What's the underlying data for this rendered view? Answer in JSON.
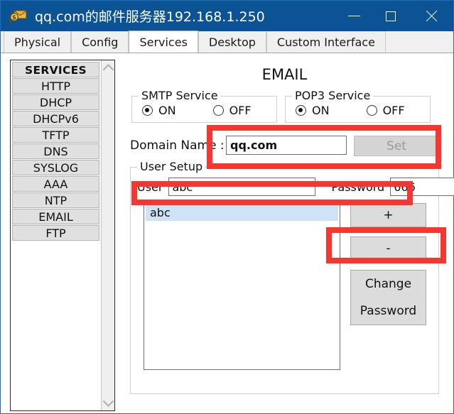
{
  "window": {
    "title": "qq.com的邮件服务器192.168.1.250",
    "icon": "mail-server-icon",
    "controls": {
      "minimize": "minimize-icon",
      "maximize": "maximize-icon",
      "close": "close-icon"
    }
  },
  "tabs": [
    {
      "label": "Physical",
      "active": false
    },
    {
      "label": "Config",
      "active": false
    },
    {
      "label": "Services",
      "active": true
    },
    {
      "label": "Desktop",
      "active": false
    },
    {
      "label": "Custom Interface",
      "active": false
    }
  ],
  "sidebar": {
    "header": "SERVICES",
    "items": [
      {
        "label": "HTTP"
      },
      {
        "label": "DHCP"
      },
      {
        "label": "DHCPv6"
      },
      {
        "label": "TFTP"
      },
      {
        "label": "DNS"
      },
      {
        "label": "SYSLOG"
      },
      {
        "label": "AAA"
      },
      {
        "label": "NTP"
      },
      {
        "label": "EMAIL"
      },
      {
        "label": "FTP"
      }
    ],
    "scrollbar": {
      "up": "chevron-up-icon",
      "down": "chevron-down-icon"
    }
  },
  "panel": {
    "title": "EMAIL",
    "smtp": {
      "group_label": "SMTP Service",
      "on_label": "ON",
      "off_label": "OFF",
      "selected": "ON"
    },
    "pop3": {
      "group_label": "POP3 Service",
      "on_label": "ON",
      "off_label": "OFF",
      "selected": "ON"
    },
    "domain": {
      "label": "Domain Name :",
      "value": "qq.com",
      "placeholder": "",
      "set_button": "Set",
      "set_button_disabled": true
    },
    "user_setup": {
      "group_label": "User Setup",
      "user_label": "User",
      "user_value": "abc",
      "user_placeholder": "",
      "password_label": "Password",
      "password_value": "666",
      "password_placeholder": "",
      "list": [
        {
          "label": "abc",
          "selected": true
        }
      ],
      "add_button": "+",
      "remove_button": "-",
      "change_password_line1": "Change",
      "change_password_line2": "Password"
    }
  },
  "annotations": {
    "accent_color": "#f9352f",
    "boxes": [
      {
        "name": "domain-row-highlight"
      },
      {
        "name": "user-password-row-highlight"
      },
      {
        "name": "add-button-highlight"
      }
    ]
  },
  "colors": {
    "titlebar": "#0b5394",
    "selection": "#cfe3f7",
    "button_face": "#dcdcdc",
    "disabled_text": "#9a9a9a"
  }
}
